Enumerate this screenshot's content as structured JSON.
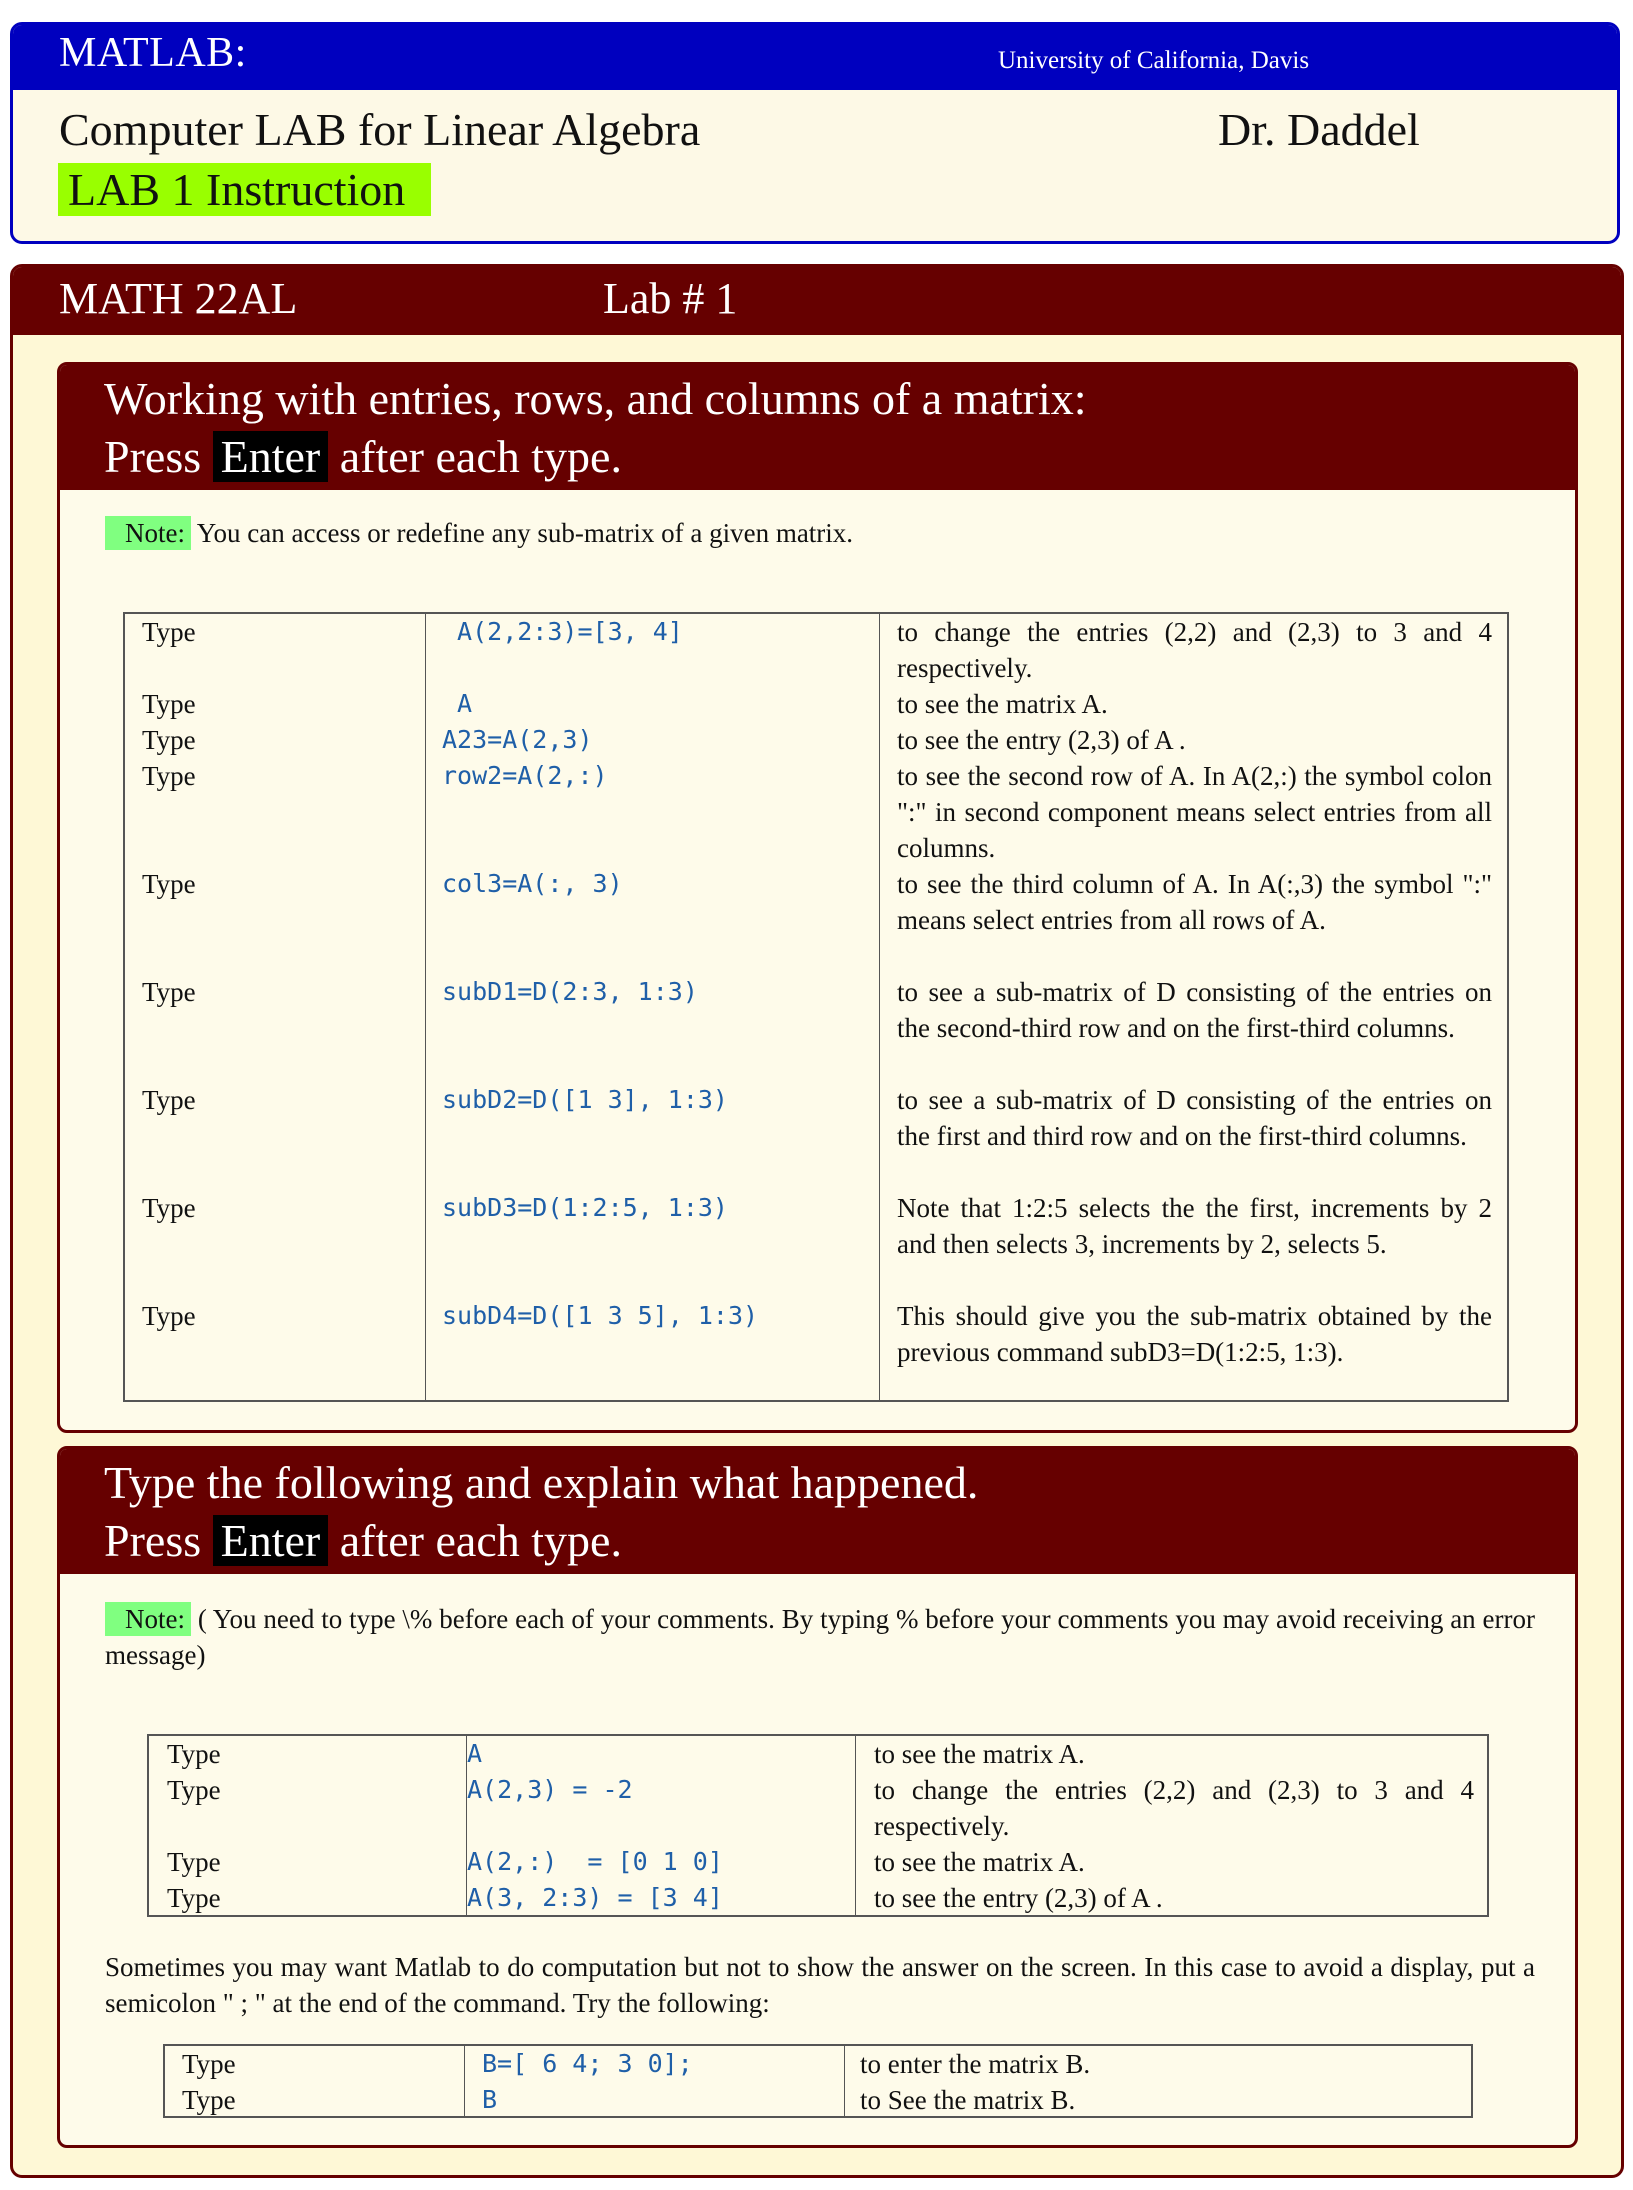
{
  "header": {
    "title": "MATLAB:",
    "university": "University of California, Davis",
    "course_title": "Computer LAB for Linear Algebra",
    "instructor": "Dr. Daddel",
    "lab_label": "LAB 1 Instruction",
    "colors": {
      "bar": "#0000bf",
      "lab_highlight": "#99ff00"
    }
  },
  "main": {
    "course": "MATH 22AL",
    "lab_number": "Lab # 1",
    "colors": {
      "bar": "#660000",
      "note_highlight": "#80ff80",
      "code": "#1f5fa8"
    }
  },
  "section1": {
    "heading_line1": "Working with entries, rows, and columns of a matrix:",
    "heading_press": "Press",
    "heading_key": "Enter",
    "heading_after": "after each type.",
    "note_label": "Note:",
    "note_text": "You can access or redefine any sub-matrix of a given matrix.",
    "rows": [
      {
        "type": "Type",
        "code": " A(2,2:3)=[3, 4]",
        "desc": "to change the entries (2,2) and (2,3) to 3 and 4 respectively."
      },
      {
        "type": "Type",
        "code": " A",
        "desc": "to see the matrix A."
      },
      {
        "type": "Type",
        "code": "A23=A(2,3)",
        "desc": "to see the entry (2,3) of A ."
      },
      {
        "type": "Type",
        "code": "row2=A(2,:)",
        "desc": "to see the second row of A. In A(2,:) the symbol colon \":\" in second component means select entries  from all columns."
      },
      {
        "type": "Type",
        "code": "col3=A(:, 3)",
        "desc": "to see the third column of A. In A(:,3) the symbol \":\" means select entries from all rows of A."
      },
      {
        "type": "Type",
        "code": "subD1=D(2:3, 1:3)",
        "desc": "to see a sub-matrix of D consisting of the entries on the second-third row and on the first-third columns."
      },
      {
        "type": "Type",
        "code": "subD2=D([1 3], 1:3)",
        "desc": "to see a sub-matrix of D consisting of the entries on the first and third row and on the first-third columns."
      },
      {
        "type": "Type",
        "code": "subD3=D(1:2:5, 1:3)",
        "desc": "Note that 1:2:5 selects the the first, increments by 2 and then selects 3, increments by 2, selects 5."
      },
      {
        "type": "Type",
        "code": "subD4=D([1 3 5], 1:3)",
        "desc": " This should give you the sub-matrix obtained by the previous command subD3=D(1:2:5, 1:3)."
      }
    ]
  },
  "section2": {
    "heading_line1": "Type the following and explain what happened.",
    "heading_press": "Press",
    "heading_key": "Enter",
    "heading_after": "after each type.",
    "note_label": "Note:",
    "note_text": "( You need to type \\% before each of your comments. By typing % before  your comments you may avoid receiving an error message)",
    "rows": [
      {
        "type": "Type",
        "code": "A",
        "desc": "to see the matrix A."
      },
      {
        "type": "Type",
        "code": "A(2,3) = -2",
        "desc": "to change the entries (2,2) and (2,3) to 3 and 4 respectively."
      },
      {
        "type": "Type",
        "code": "A(2,:)  = [0 1 0]",
        "desc": "to see the matrix A."
      },
      {
        "type": "Type",
        "code": "A(3, 2:3) = [3 4]",
        "desc": "to see the entry (2,3) of A ."
      }
    ],
    "paragraph": "Sometimes you may want Matlab to do computation but not to show the answer on the screen. In this case to avoid a display, put a semicolon \" ; \" at the end of the command. Try the following:",
    "rows2": [
      {
        "type": "Type",
        "code": "B=[ 6 4; 3 0];",
        "desc": "to enter the matrix B."
      },
      {
        "type": "Type",
        "code": "B",
        "desc": "to See the matrix B."
      }
    ]
  }
}
